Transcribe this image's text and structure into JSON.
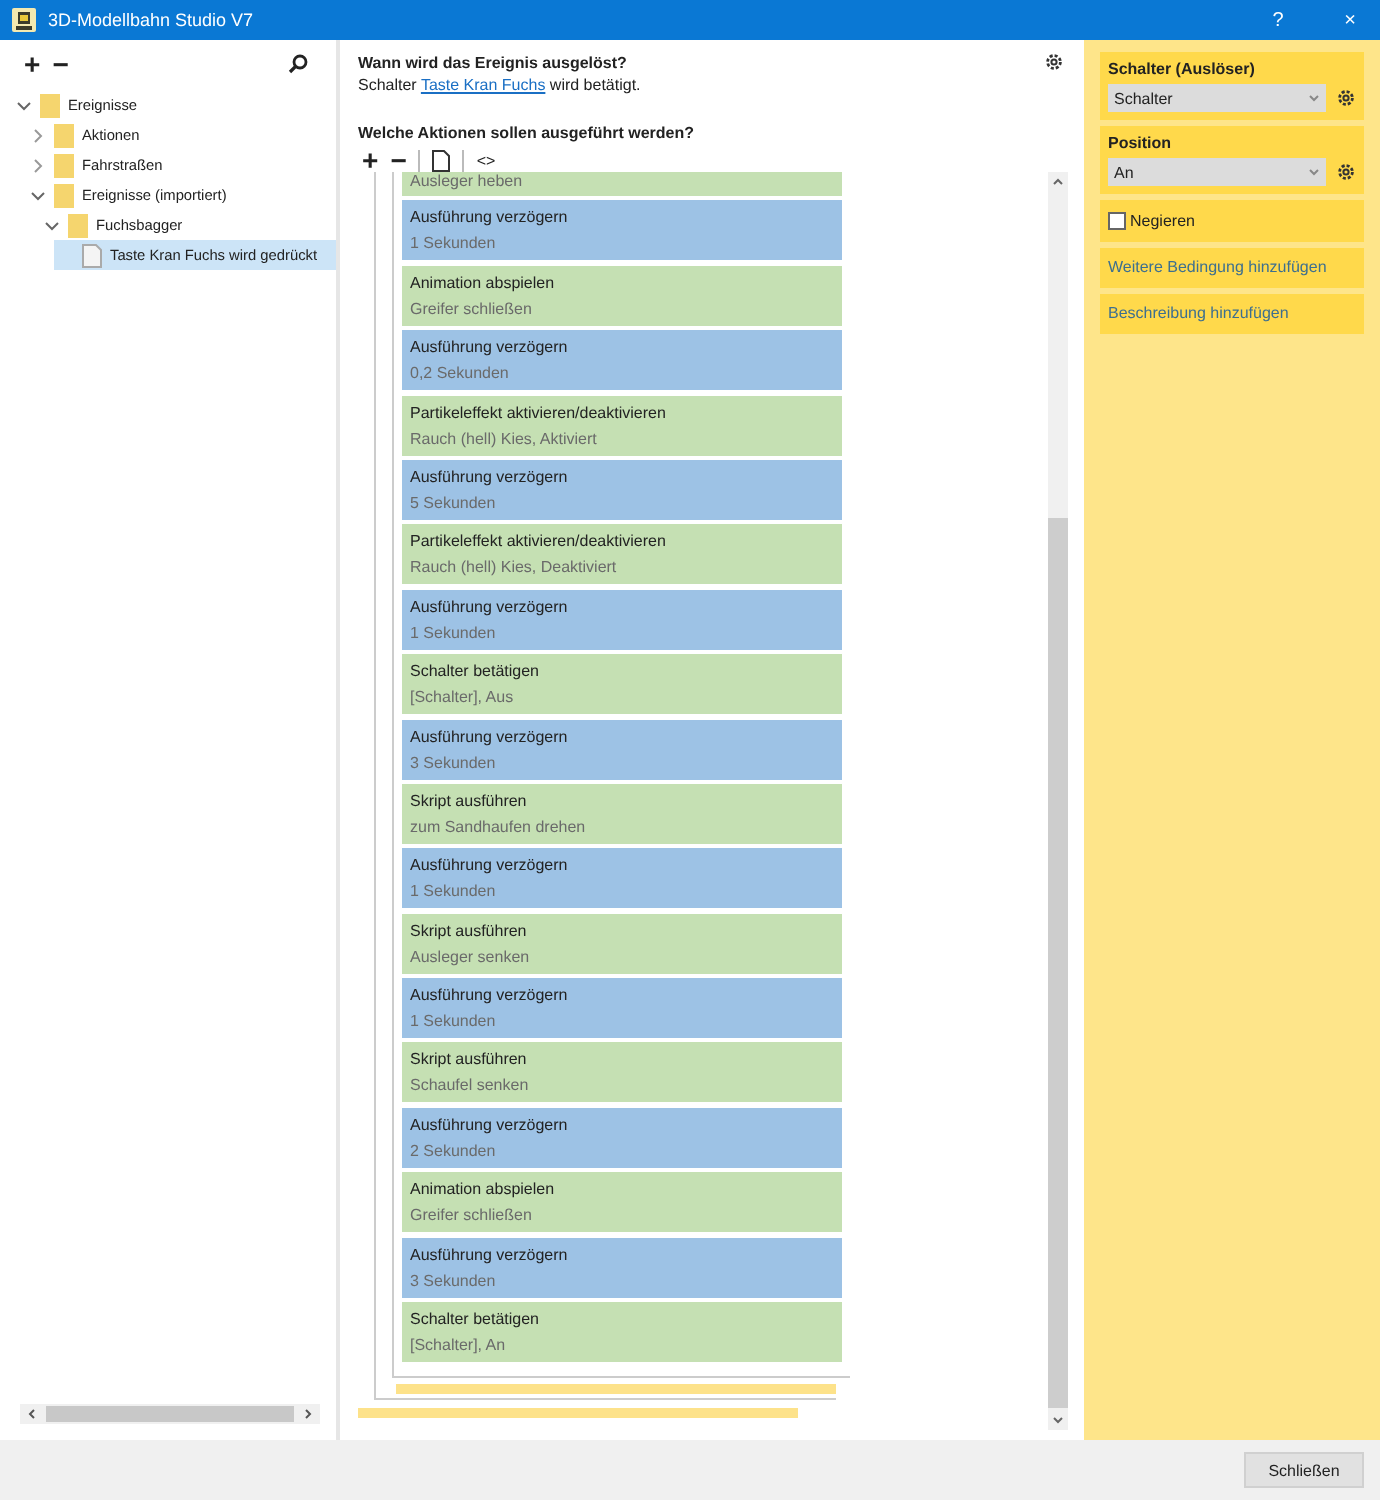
{
  "window": {
    "title": "3D-Modellbahn Studio V7",
    "help": "?",
    "close": "×"
  },
  "tree_toolbar": {
    "add": "+",
    "remove": "−"
  },
  "tree": [
    {
      "label": "Ereignisse",
      "kind": "folder",
      "expanded": true,
      "selected": false,
      "children": [
        {
          "label": "Aktionen",
          "kind": "folder",
          "expanded": false,
          "selected": false
        },
        {
          "label": "Fahrstraßen",
          "kind": "folder",
          "expanded": false,
          "selected": false
        },
        {
          "label": "Ereignisse (importiert)",
          "kind": "folder",
          "expanded": true,
          "selected": false,
          "children": [
            {
              "label": "Fuchsbagger",
              "kind": "folder",
              "expanded": true,
              "selected": false,
              "children": [
                {
                  "label": "Taste Kran Fuchs wird gedrückt",
                  "kind": "event",
                  "selected": true
                }
              ]
            }
          ]
        }
      ]
    }
  ],
  "event": {
    "heading": "Wann wird das Ereignis ausgelöst?",
    "text_before": "Schalter",
    "link": "Taste Kran Fuchs",
    "text_after": "wird betätigt."
  },
  "actions_heading": "Welche Aktionen sollen ausgeführt werden?",
  "actions_toolbar": {
    "add": "+",
    "remove": "−",
    "code": "<>"
  },
  "actions": [
    {
      "kind": "action",
      "detail": "Ausleger heben"
    },
    {
      "kind": "delay",
      "title": "Ausführung verzögern",
      "detail": "1 Sekunden"
    },
    {
      "kind": "action",
      "title": "Animation abspielen",
      "detail": "Greifer schließen"
    },
    {
      "kind": "delay",
      "title": "Ausführung verzögern",
      "detail": "0,2 Sekunden"
    },
    {
      "kind": "action",
      "title": "Partikeleffekt aktivieren/deaktivieren",
      "detail": "Rauch (hell) Kies, Aktiviert"
    },
    {
      "kind": "delay",
      "title": "Ausführung verzögern",
      "detail": "5 Sekunden"
    },
    {
      "kind": "action",
      "title": "Partikeleffekt aktivieren/deaktivieren",
      "detail": "Rauch (hell) Kies, Deaktiviert"
    },
    {
      "kind": "delay",
      "title": "Ausführung verzögern",
      "detail": "1 Sekunden"
    },
    {
      "kind": "action",
      "title": "Schalter betätigen",
      "detail": "[Schalter], Aus"
    },
    {
      "kind": "delay",
      "title": "Ausführung verzögern",
      "detail": "3 Sekunden"
    },
    {
      "kind": "action",
      "title": "Skript ausführen",
      "detail": "zum Sandhaufen drehen"
    },
    {
      "kind": "delay",
      "title": "Ausführung verzögern",
      "detail": "1 Sekunden"
    },
    {
      "kind": "action",
      "title": "Skript ausführen",
      "detail": "Ausleger senken"
    },
    {
      "kind": "delay",
      "title": "Ausführung verzögern",
      "detail": "1 Sekunden"
    },
    {
      "kind": "action",
      "title": "Skript ausführen",
      "detail": "Schaufel senken"
    },
    {
      "kind": "delay",
      "title": "Ausführung verzögern",
      "detail": "2 Sekunden"
    },
    {
      "kind": "action",
      "title": "Animation abspielen",
      "detail": "Greifer schließen"
    },
    {
      "kind": "delay",
      "title": "Ausführung verzögern",
      "detail": "3 Sekunden"
    },
    {
      "kind": "action",
      "title": "Schalter betätigen",
      "detail": "[Schalter], An"
    }
  ],
  "trigger": {
    "label": "Schalter (Auslöser)",
    "value": "Schalter"
  },
  "position": {
    "label": "Position",
    "value": "An"
  },
  "negate": {
    "label": "Negieren",
    "checked": false
  },
  "links": [
    "Weitere Bedingung hinzufügen",
    "Beschreibung hinzufügen"
  ],
  "footer_button": "Schließen"
}
